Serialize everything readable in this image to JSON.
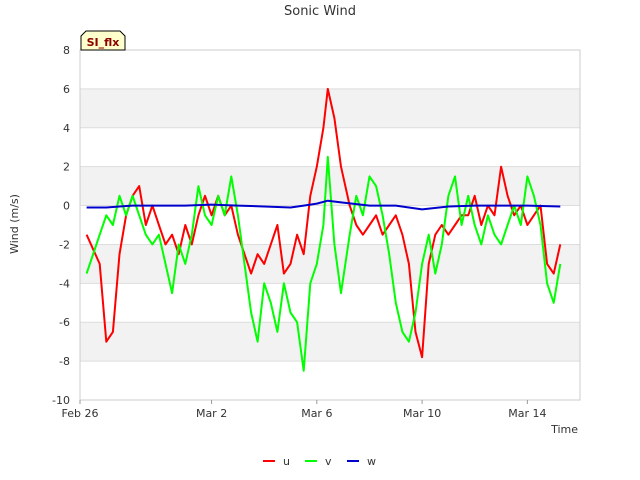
{
  "chart_data": {
    "type": "line",
    "title": "Sonic Wind",
    "tag": "SI_flx",
    "xlabel": "Time",
    "ylabel": "Wind (m/s)",
    "ylim": [
      -10,
      8
    ],
    "yticks": [
      -10,
      -8,
      -6,
      -4,
      -2,
      0,
      2,
      4,
      6,
      8
    ],
    "xlim": [
      "2024-02-26",
      "2024-03-16"
    ],
    "xticks": [
      {
        "date": "2024-02-26",
        "label": "Feb 26"
      },
      {
        "date": "2024-03-02",
        "label": "Mar 2"
      },
      {
        "date": "2024-03-06",
        "label": "Mar 6"
      },
      {
        "date": "2024-03-10",
        "label": "Mar 10"
      },
      {
        "date": "2024-03-14",
        "label": "Mar 14"
      }
    ],
    "grid": true,
    "band_shading": true,
    "legend_position": "bottom",
    "series": [
      {
        "name": "u",
        "color": "#ff0000",
        "points": [
          [
            "2024-02-26T06:00",
            -1.5
          ],
          [
            "2024-02-26T18:00",
            -3.0
          ],
          [
            "2024-02-27T00:00",
            -7.0
          ],
          [
            "2024-02-27T06:00",
            -6.5
          ],
          [
            "2024-02-27T12:00",
            -2.5
          ],
          [
            "2024-02-27T18:00",
            -0.5
          ],
          [
            "2024-02-28T00:00",
            0.5
          ],
          [
            "2024-02-28T06:00",
            1.0
          ],
          [
            "2024-02-28T12:00",
            -1.0
          ],
          [
            "2024-02-28T18:00",
            0.0
          ],
          [
            "2024-02-29T00:00",
            -1.0
          ],
          [
            "2024-02-29T06:00",
            -2.0
          ],
          [
            "2024-02-29T12:00",
            -1.5
          ],
          [
            "2024-02-29T18:00",
            -2.5
          ],
          [
            "2024-03-01T00:00",
            -1.0
          ],
          [
            "2024-03-01T06:00",
            -2.0
          ],
          [
            "2024-03-01T12:00",
            -0.5
          ],
          [
            "2024-03-01T18:00",
            0.5
          ],
          [
            "2024-03-02T00:00",
            -0.5
          ],
          [
            "2024-03-02T06:00",
            0.5
          ],
          [
            "2024-03-02T12:00",
            -0.5
          ],
          [
            "2024-03-02T18:00",
            0.0
          ],
          [
            "2024-03-03T00:00",
            -1.5
          ],
          [
            "2024-03-03T06:00",
            -2.5
          ],
          [
            "2024-03-03T12:00",
            -3.5
          ],
          [
            "2024-03-03T18:00",
            -2.5
          ],
          [
            "2024-03-04T00:00",
            -3.0
          ],
          [
            "2024-03-04T06:00",
            -2.0
          ],
          [
            "2024-03-04T12:00",
            -1.0
          ],
          [
            "2024-03-04T18:00",
            -3.5
          ],
          [
            "2024-03-05T00:00",
            -3.0
          ],
          [
            "2024-03-05T06:00",
            -1.5
          ],
          [
            "2024-03-05T12:00",
            -2.5
          ],
          [
            "2024-03-05T18:00",
            0.5
          ],
          [
            "2024-03-06T00:00",
            2.0
          ],
          [
            "2024-03-06T06:00",
            4.0
          ],
          [
            "2024-03-06T10:00",
            6.0
          ],
          [
            "2024-03-06T16:00",
            4.5
          ],
          [
            "2024-03-06T22:00",
            2.0
          ],
          [
            "2024-03-07T06:00",
            0.0
          ],
          [
            "2024-03-07T12:00",
            -1.0
          ],
          [
            "2024-03-07T18:00",
            -1.5
          ],
          [
            "2024-03-08T00:00",
            -1.0
          ],
          [
            "2024-03-08T06:00",
            -0.5
          ],
          [
            "2024-03-08T12:00",
            -1.5
          ],
          [
            "2024-03-08T18:00",
            -1.0
          ],
          [
            "2024-03-09T00:00",
            -0.5
          ],
          [
            "2024-03-09T06:00",
            -1.5
          ],
          [
            "2024-03-09T12:00",
            -3.0
          ],
          [
            "2024-03-09T18:00",
            -6.5
          ],
          [
            "2024-03-10T00:00",
            -7.8
          ],
          [
            "2024-03-10T06:00",
            -3.0
          ],
          [
            "2024-03-10T12:00",
            -1.5
          ],
          [
            "2024-03-10T18:00",
            -1.0
          ],
          [
            "2024-03-11T00:00",
            -1.5
          ],
          [
            "2024-03-11T06:00",
            -1.0
          ],
          [
            "2024-03-11T12:00",
            -0.5
          ],
          [
            "2024-03-11T18:00",
            -0.5
          ],
          [
            "2024-03-12T00:00",
            0.5
          ],
          [
            "2024-03-12T06:00",
            -1.0
          ],
          [
            "2024-03-12T12:00",
            0.0
          ],
          [
            "2024-03-12T18:00",
            -0.5
          ],
          [
            "2024-03-13T00:00",
            2.0
          ],
          [
            "2024-03-13T06:00",
            0.5
          ],
          [
            "2024-03-13T12:00",
            -0.5
          ],
          [
            "2024-03-13T18:00",
            0.0
          ],
          [
            "2024-03-14T00:00",
            -1.0
          ],
          [
            "2024-03-14T06:00",
            -0.5
          ],
          [
            "2024-03-14T12:00",
            0.0
          ],
          [
            "2024-03-14T18:00",
            -3.0
          ],
          [
            "2024-03-15T00:00",
            -3.5
          ],
          [
            "2024-03-15T06:00",
            -2.0
          ]
        ]
      },
      {
        "name": "v",
        "color": "#00ff00",
        "points": [
          [
            "2024-02-26T06:00",
            -3.5
          ],
          [
            "2024-02-26T18:00",
            -1.5
          ],
          [
            "2024-02-27T00:00",
            -0.5
          ],
          [
            "2024-02-27T06:00",
            -1.0
          ],
          [
            "2024-02-27T12:00",
            0.5
          ],
          [
            "2024-02-27T18:00",
            -0.5
          ],
          [
            "2024-02-28T00:00",
            0.5
          ],
          [
            "2024-02-28T06:00",
            -0.5
          ],
          [
            "2024-02-28T12:00",
            -1.5
          ],
          [
            "2024-02-28T18:00",
            -2.0
          ],
          [
            "2024-02-29T00:00",
            -1.5
          ],
          [
            "2024-02-29T06:00",
            -3.0
          ],
          [
            "2024-02-29T12:00",
            -4.5
          ],
          [
            "2024-02-29T18:00",
            -2.0
          ],
          [
            "2024-03-01T00:00",
            -3.0
          ],
          [
            "2024-03-01T06:00",
            -1.5
          ],
          [
            "2024-03-01T12:00",
            1.0
          ],
          [
            "2024-03-01T18:00",
            -0.5
          ],
          [
            "2024-03-02T00:00",
            -1.0
          ],
          [
            "2024-03-02T06:00",
            0.5
          ],
          [
            "2024-03-02T12:00",
            -0.5
          ],
          [
            "2024-03-02T18:00",
            1.5
          ],
          [
            "2024-03-03T00:00",
            -0.5
          ],
          [
            "2024-03-03T06:00",
            -3.0
          ],
          [
            "2024-03-03T12:00",
            -5.5
          ],
          [
            "2024-03-03T18:00",
            -7.0
          ],
          [
            "2024-03-04T00:00",
            -4.0
          ],
          [
            "2024-03-04T06:00",
            -5.0
          ],
          [
            "2024-03-04T12:00",
            -6.5
          ],
          [
            "2024-03-04T18:00",
            -4.0
          ],
          [
            "2024-03-05T00:00",
            -5.5
          ],
          [
            "2024-03-05T06:00",
            -6.0
          ],
          [
            "2024-03-05T12:00",
            -8.5
          ],
          [
            "2024-03-05T18:00",
            -4.0
          ],
          [
            "2024-03-06T00:00",
            -3.0
          ],
          [
            "2024-03-06T06:00",
            -1.0
          ],
          [
            "2024-03-06T10:00",
            2.5
          ],
          [
            "2024-03-06T16:00",
            -2.0
          ],
          [
            "2024-03-06T22:00",
            -4.5
          ],
          [
            "2024-03-07T06:00",
            -1.5
          ],
          [
            "2024-03-07T12:00",
            0.5
          ],
          [
            "2024-03-07T18:00",
            -0.5
          ],
          [
            "2024-03-08T00:00",
            1.5
          ],
          [
            "2024-03-08T06:00",
            1.0
          ],
          [
            "2024-03-08T12:00",
            -0.5
          ],
          [
            "2024-03-08T18:00",
            -2.5
          ],
          [
            "2024-03-09T00:00",
            -5.0
          ],
          [
            "2024-03-09T06:00",
            -6.5
          ],
          [
            "2024-03-09T12:00",
            -7.0
          ],
          [
            "2024-03-09T18:00",
            -5.5
          ],
          [
            "2024-03-10T00:00",
            -3.0
          ],
          [
            "2024-03-10T06:00",
            -1.5
          ],
          [
            "2024-03-10T12:00",
            -3.5
          ],
          [
            "2024-03-10T18:00",
            -2.0
          ],
          [
            "2024-03-11T00:00",
            0.5
          ],
          [
            "2024-03-11T06:00",
            1.5
          ],
          [
            "2024-03-11T12:00",
            -1.0
          ],
          [
            "2024-03-11T18:00",
            0.5
          ],
          [
            "2024-03-12T00:00",
            -1.0
          ],
          [
            "2024-03-12T06:00",
            -2.0
          ],
          [
            "2024-03-12T12:00",
            -0.5
          ],
          [
            "2024-03-12T18:00",
            -1.5
          ],
          [
            "2024-03-13T00:00",
            -2.0
          ],
          [
            "2024-03-13T06:00",
            -1.0
          ],
          [
            "2024-03-13T12:00",
            0.0
          ],
          [
            "2024-03-13T18:00",
            -1.0
          ],
          [
            "2024-03-14T00:00",
            1.5
          ],
          [
            "2024-03-14T06:00",
            0.5
          ],
          [
            "2024-03-14T12:00",
            -1.0
          ],
          [
            "2024-03-14T18:00",
            -4.0
          ],
          [
            "2024-03-15T00:00",
            -5.0
          ],
          [
            "2024-03-15T06:00",
            -3.0
          ]
        ]
      },
      {
        "name": "w",
        "color": "#0000cc",
        "points": [
          [
            "2024-02-26T06:00",
            -0.1
          ],
          [
            "2024-02-27T00:00",
            -0.1
          ],
          [
            "2024-02-28T00:00",
            0.0
          ],
          [
            "2024-02-29T00:00",
            0.0
          ],
          [
            "2024-03-01T00:00",
            0.0
          ],
          [
            "2024-03-02T00:00",
            0.05
          ],
          [
            "2024-03-03T00:00",
            0.0
          ],
          [
            "2024-03-04T00:00",
            -0.05
          ],
          [
            "2024-03-05T00:00",
            -0.1
          ],
          [
            "2024-03-05T12:00",
            0.0
          ],
          [
            "2024-03-06T00:00",
            0.1
          ],
          [
            "2024-03-06T10:00",
            0.25
          ],
          [
            "2024-03-07T00:00",
            0.15
          ],
          [
            "2024-03-08T00:00",
            0.0
          ],
          [
            "2024-03-09T00:00",
            0.0
          ],
          [
            "2024-03-10T00:00",
            -0.2
          ],
          [
            "2024-03-11T00:00",
            -0.05
          ],
          [
            "2024-03-12T00:00",
            0.0
          ],
          [
            "2024-03-13T00:00",
            0.0
          ],
          [
            "2024-03-14T00:00",
            0.0
          ],
          [
            "2024-03-15T06:00",
            -0.05
          ]
        ]
      }
    ]
  }
}
